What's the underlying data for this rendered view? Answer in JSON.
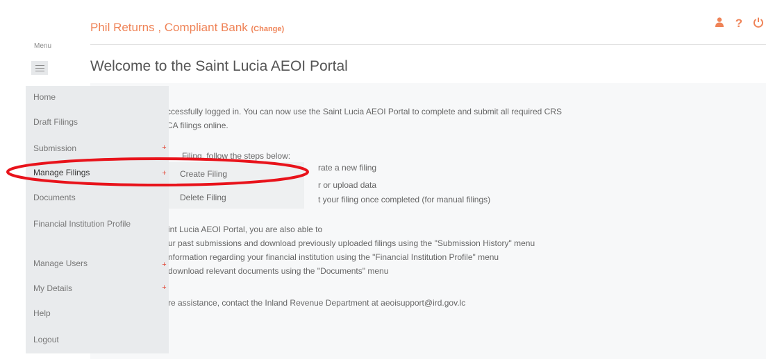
{
  "header": {
    "title": "Phil Returns , Compliant Bank",
    "change_label": "(Change)",
    "icons": [
      "user-icon",
      "help-icon",
      "power-icon"
    ],
    "help_glyph": "?"
  },
  "menu_label": "Menu",
  "welcome_title": "Welcome to the Saint Lucia AEOI Portal",
  "content": {
    "line1": "ccessfully logged in. You can now use the Saint Lucia AEOI Portal to complete and submit all required CRS",
    "line2": "CA filings online.",
    "line3": "Filing, follow the steps below:",
    "line4": "rate a new filing",
    "line5": "r or upload data",
    "line6": "t your filing once completed (for manual filings)",
    "line7": "int Lucia AEOI Portal, you are also able to",
    "line8": "ur past submissions and download previously uploaded filings using the \"Submission History\" menu",
    "line9": "nformation regarding your financial institution using the \"Financial Institution Profile\" menu",
    "line10": "download relevant documents using the \"Documents\" menu",
    "line11": "re assistance, contact the Inland Revenue Department at aeoisupport@ird.gov.lc"
  },
  "sidebar": {
    "items": [
      {
        "label": "Home"
      },
      {
        "label": "Draft Filings"
      },
      {
        "label": "Submission"
      },
      {
        "label": "Manage Filings"
      },
      {
        "label": "Documents"
      },
      {
        "label": "Financial Institution Profile"
      },
      {
        "label": "Manage Users"
      },
      {
        "label": "My Details"
      },
      {
        "label": "Help"
      },
      {
        "label": "Logout"
      }
    ]
  },
  "submenu": {
    "items": [
      {
        "label": "Create Filing"
      },
      {
        "label": "Delete Filing"
      }
    ]
  },
  "expand_marker": "+",
  "colors": {
    "accent": "#ef8357",
    "highlight": "#e8131b",
    "marker": "#e34a3a"
  }
}
